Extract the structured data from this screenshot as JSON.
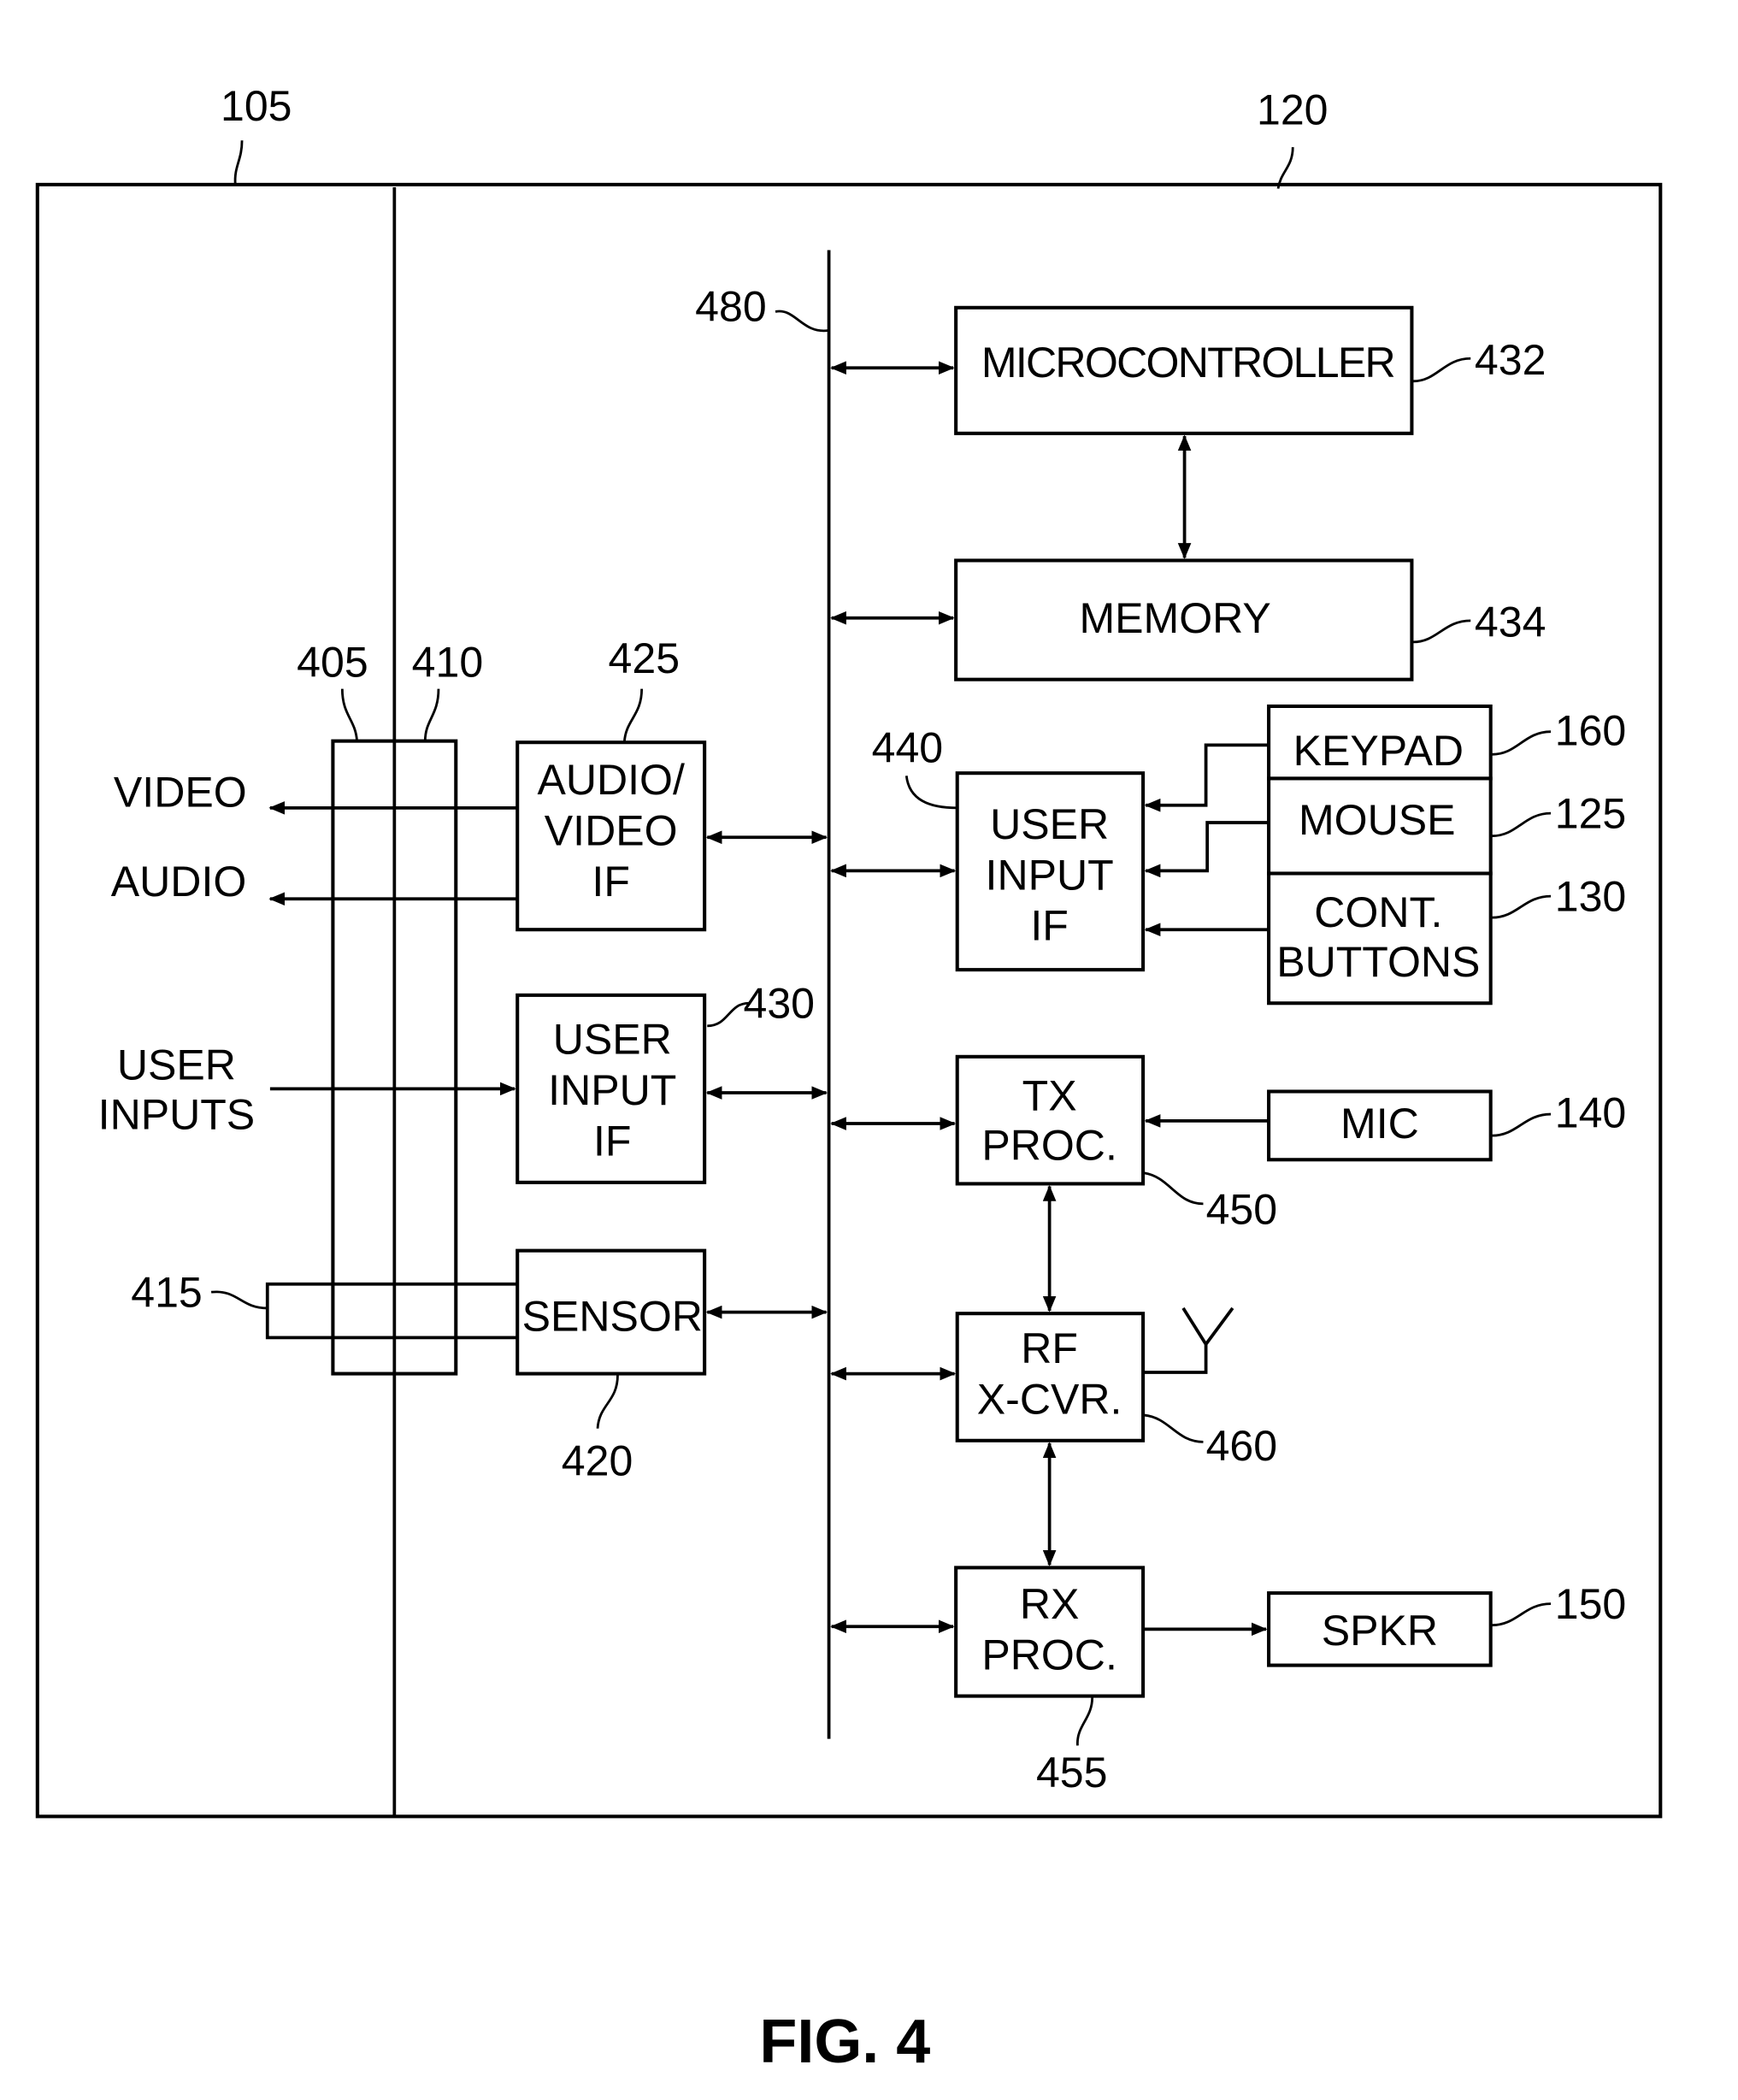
{
  "figure": {
    "title": "FIG. 4",
    "refs": {
      "device": "105",
      "module": "120",
      "bus": "480",
      "connector_a": "405",
      "connector_b": "410",
      "sensor_port": "415",
      "sensor": "420",
      "av_if": "425",
      "user_input_if_left": "430",
      "microcontroller": "432",
      "memory": "434",
      "user_input_if_right": "440",
      "tx_proc": "450",
      "rx_proc": "455",
      "rf_xcvr": "460",
      "keypad": "160",
      "mouse": "125",
      "cont_buttons": "130",
      "mic": "140",
      "spkr": "150"
    },
    "blocks": {
      "microcontroller": [
        "MICROCONTROLLER"
      ],
      "memory": [
        "MEMORY"
      ],
      "av_if": [
        "AUDIO/",
        "VIDEO",
        "IF"
      ],
      "user_input_if_left": [
        "USER",
        "INPUT",
        "IF"
      ],
      "sensor": [
        "SENSOR"
      ],
      "user_input_if_right": [
        "USER",
        "INPUT",
        "IF"
      ],
      "keypad": [
        "KEYPAD"
      ],
      "mouse": [
        "MOUSE"
      ],
      "cont_buttons": [
        "CONT.",
        "BUTTONS"
      ],
      "tx_proc": [
        "TX",
        "PROC."
      ],
      "mic": [
        "MIC"
      ],
      "rf_xcvr": [
        "RF",
        "X-CVR."
      ],
      "rx_proc": [
        "RX",
        "PROC."
      ],
      "spkr": [
        "SPKR"
      ]
    },
    "signals": {
      "video": "VIDEO",
      "audio": "AUDIO",
      "user_inputs": [
        "USER",
        "INPUTS"
      ]
    }
  }
}
